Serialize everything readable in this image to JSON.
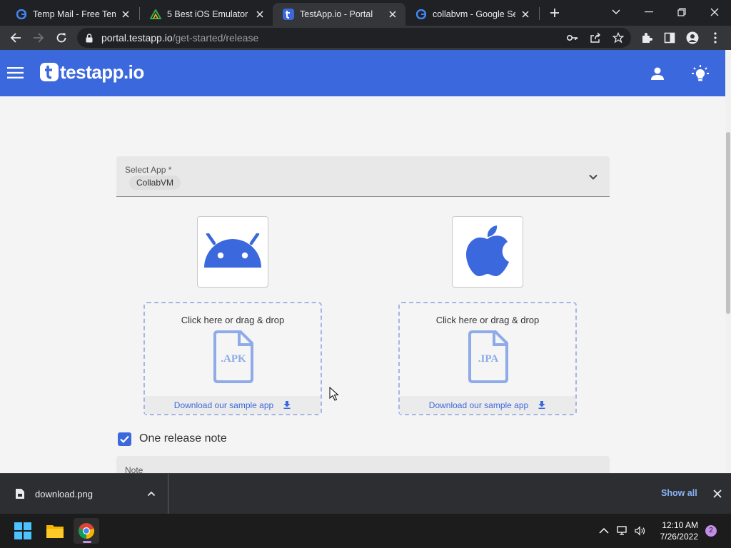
{
  "browser": {
    "tabs": [
      {
        "title": "Temp Mail - Free Temp",
        "active": false
      },
      {
        "title": "5 Best iOS Emulator On",
        "active": false
      },
      {
        "title": "TestApp.io - Portal",
        "active": true
      },
      {
        "title": "collabvm - Google Sea",
        "active": false
      }
    ],
    "url_host": "portal.testapp.io",
    "url_path": "/get-started/release"
  },
  "header": {
    "logo_text": "testapp.io",
    "brand_color": "#3b68dd"
  },
  "form": {
    "select_app_label": "Select App *",
    "select_app_value": "CollabVM",
    "android": {
      "prompt": "Click here or drag & drop",
      "file_ext": ".APK",
      "sample_link": "Download our sample app"
    },
    "ios": {
      "prompt": "Click here or drag & drop",
      "file_ext": ".IPA",
      "sample_link": "Download our sample app"
    },
    "release_note_checkbox": "One release note",
    "release_note_checked": true,
    "note_label": "Note"
  },
  "downloads": {
    "file_name": "download.png",
    "show_all": "Show all"
  },
  "taskbar": {
    "time": "12:10 AM",
    "date": "7/26/2022",
    "notification_count": "2"
  }
}
